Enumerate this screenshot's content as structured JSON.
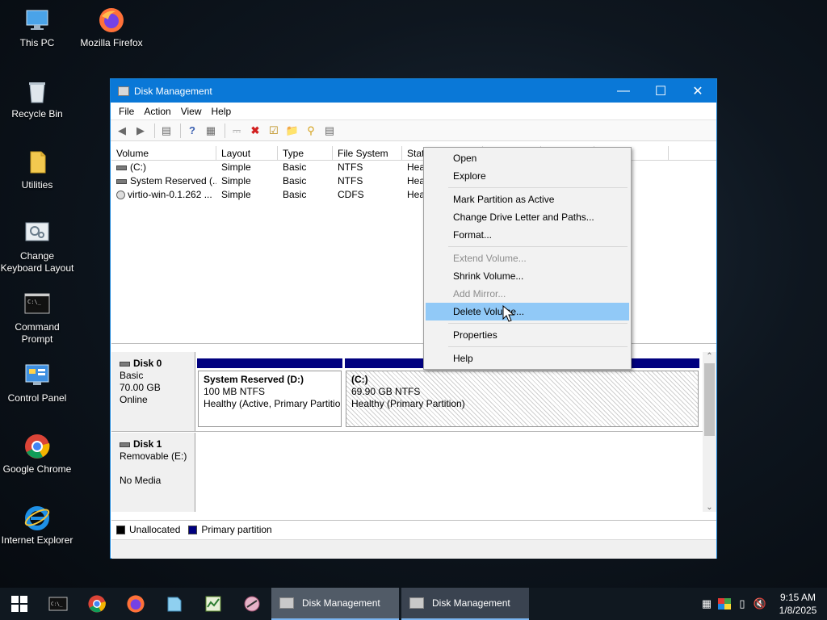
{
  "desktop": {
    "icons": [
      {
        "label": "This PC",
        "icon": "this-pc-icon"
      },
      {
        "label": "Mozilla Firefox",
        "icon": "firefox-icon"
      },
      {
        "label": "Recycle Bin",
        "icon": "recycle-bin-icon"
      },
      {
        "label": "Utilities",
        "icon": "folder-icon"
      },
      {
        "label": "Change Keyboard Layout",
        "icon": "keyboard-layout-icon"
      },
      {
        "label": "Command Prompt",
        "icon": "command-prompt-icon"
      },
      {
        "label": "Control Panel",
        "icon": "control-panel-icon"
      },
      {
        "label": "Google Chrome",
        "icon": "chrome-icon"
      },
      {
        "label": "Internet Explorer",
        "icon": "internet-explorer-icon"
      }
    ]
  },
  "window": {
    "title": "Disk Management",
    "menu": [
      "File",
      "Action",
      "View",
      "Help"
    ],
    "columns": [
      "Volume",
      "Layout",
      "Type",
      "File System",
      "Stat"
    ],
    "volumes": [
      {
        "volume": "(C:)",
        "layout": "Simple",
        "type": "Basic",
        "fs": "NTFS",
        "status": "Hea"
      },
      {
        "volume": "System Reserved (...",
        "layout": "Simple",
        "type": "Basic",
        "fs": "NTFS",
        "status": "Hea"
      },
      {
        "volume": "virtio-win-0.1.262 ...",
        "layout": "Simple",
        "type": "Basic",
        "fs": "CDFS",
        "status": "Hea"
      }
    ],
    "disks": [
      {
        "name": "Disk 0",
        "type": "Basic",
        "size": "70.00 GB",
        "state": "Online",
        "partitions": [
          {
            "name": "System Reserved  (D:)",
            "size": "100 MB NTFS",
            "status": "Healthy (Active, Primary Partition)"
          },
          {
            "name": "(C:)",
            "size": "69.90 GB NTFS",
            "status": "Healthy (Primary Partition)"
          }
        ]
      },
      {
        "name": "Disk 1",
        "type": "Removable (E:)",
        "state": "No Media"
      }
    ],
    "legend": [
      {
        "label": "Unallocated",
        "color": "#000000"
      },
      {
        "label": "Primary partition",
        "color": "#00007f"
      }
    ]
  },
  "context_menu": {
    "items": [
      "Open",
      "Explore",
      "Mark Partition as Active",
      "Change Drive Letter and Paths...",
      "Format...",
      "Extend Volume...",
      "Shrink Volume...",
      "Add Mirror...",
      "Delete Volume...",
      "Properties",
      "Help"
    ],
    "highlighted": "Delete Volume...",
    "disabled": [
      "Extend Volume...",
      "Add Mirror..."
    ]
  },
  "taskbar": {
    "apps": [
      "Disk Management",
      "Disk Management"
    ],
    "time": "9:15 AM",
    "date": "1/8/2025"
  },
  "colors": {
    "titlebar": "#0a78d7",
    "primary_partition": "#00007f",
    "menu_highlight": "#91c9f7"
  }
}
